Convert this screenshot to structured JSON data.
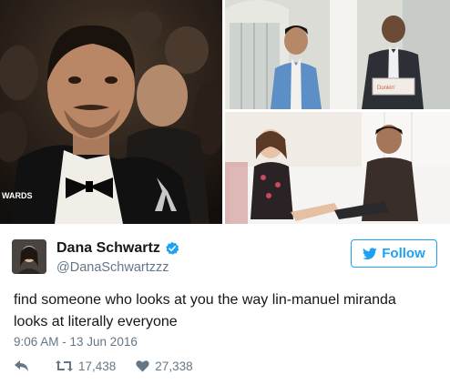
{
  "images": [
    {
      "icon": "photo-award-ceremony-audience",
      "overlay_text": "WARDS"
    },
    {
      "icon": "photo-white-house-visit",
      "box_text": "Dunkin'"
    },
    {
      "icon": "photo-interview-on-couch"
    }
  ],
  "tweet": {
    "display_name": "Dana Schwartz",
    "handle": "@DanaSchwartzzz",
    "verified_icon": "verified-badge-icon",
    "follow_label": "Follow",
    "text": "find someone who looks at you the way lin-manuel miranda looks at literally everyone",
    "timestamp": "9:06 AM - 13 Jun 2016",
    "retweets": "17,438",
    "likes": "27,338"
  },
  "colors": {
    "accent": "#1da1f2",
    "text": "#14171a",
    "muted": "#657786"
  }
}
